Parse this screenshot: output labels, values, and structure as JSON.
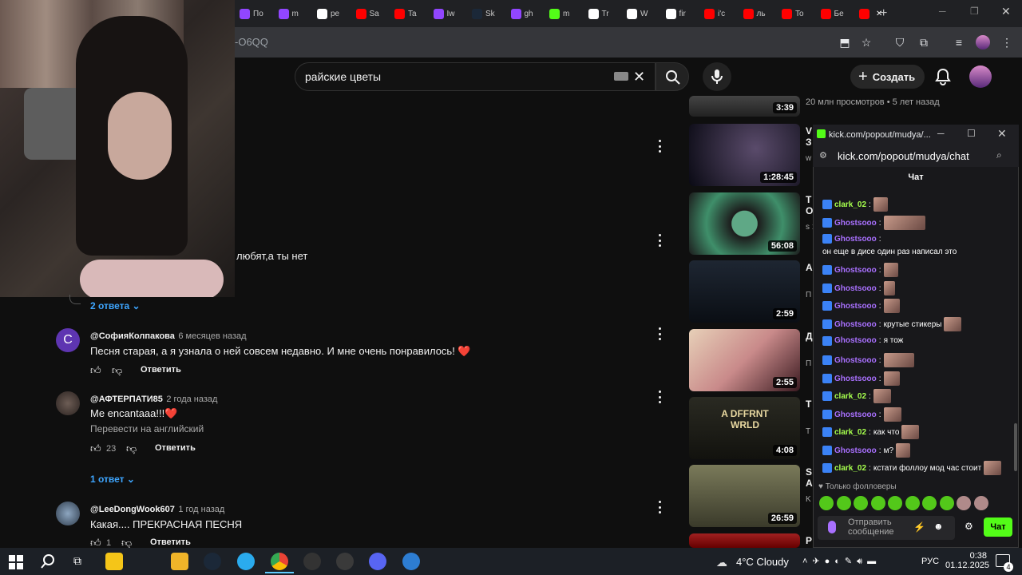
{
  "browser": {
    "tabs": [
      "По",
      "m",
      "ре",
      "Sa",
      "Ta",
      "Iw",
      "Sk",
      "gh",
      "m",
      "Tr",
      "W",
      "fir",
      "i'c",
      "ль",
      "To",
      "Бе",
      ""
    ],
    "address": "-O6QQ",
    "new_tab": "+"
  },
  "youtube": {
    "search_value": "райские цветы",
    "create_label": "Создать"
  },
  "comments": {
    "partial_text": "любят,а ты нет",
    "show_replies_1": "2 ответа",
    "c1": {
      "author": "@СофияКолпакова",
      "time": "6 месяцев назад",
      "text": "Песня старая, а я узнала о ней совсем недавно. И мне очень понравилось! ❤️",
      "reply": "Ответить",
      "avatar_letter": "С"
    },
    "c2": {
      "author": "@АФТЕРПАТИ85",
      "time": "2 года назад",
      "text": "Me encantaaa!!!❤️",
      "translate": "Перевести на английский",
      "likes": "23",
      "reply": "Ответить"
    },
    "show_replies_2": "1 ответ",
    "c3": {
      "author": "@LeeDongWook607",
      "time": "1 год назад",
      "text": "Какая.... ПРЕКРАСНАЯ ПЕСНЯ",
      "likes": "1",
      "reply": "Ответить"
    }
  },
  "sidebar": {
    "top_meta": "20 млн просмотров • 5 лет назад",
    "videos": [
      {
        "duration": "3:39",
        "title": "",
        "meta": ""
      },
      {
        "duration": "1:28:45",
        "title": "V З",
        "meta": "w"
      },
      {
        "duration": "56:08",
        "title": "Т О",
        "meta": "s 1,"
      },
      {
        "duration": "2:59",
        "title": "А",
        "meta": "П 15"
      },
      {
        "duration": "2:55",
        "title": "Д",
        "meta": "П 26"
      },
      {
        "duration": "4:08",
        "title": "Т",
        "meta": "Т 1"
      },
      {
        "duration": "26:59",
        "title": "S А",
        "meta": "K 7"
      },
      {
        "duration": "",
        "title": "Р",
        "meta": ""
      }
    ],
    "album_text": "A DFFRNT WRLD"
  },
  "kick": {
    "window_title": "kick.com/popout/mudya/...",
    "url": "kick.com/popout/mudya/chat",
    "header": "Чат",
    "messages": [
      {
        "user": "clark_02",
        "text": "",
        "color": "#a6ff4d"
      },
      {
        "user": "Ghostsooo",
        "text": "",
        "color": "#a970ff"
      },
      {
        "user": "Ghostsooo",
        "text": "он еще в дисе один раз написал это",
        "color": "#a970ff"
      },
      {
        "user": "Ghostsooo",
        "text": "",
        "color": "#a970ff"
      },
      {
        "user": "Ghostsooo",
        "text": "",
        "color": "#a970ff"
      },
      {
        "user": "Ghostsooo",
        "text": "",
        "color": "#a970ff"
      },
      {
        "user": "Ghostsooo",
        "text": "крутые стикеры",
        "color": "#a970ff"
      },
      {
        "user": "Ghostsooo",
        "text": "я тож",
        "color": "#a970ff"
      },
      {
        "user": "Ghostsooo",
        "text": "",
        "color": "#a970ff"
      },
      {
        "user": "Ghostsooo",
        "text": "",
        "color": "#a970ff"
      },
      {
        "user": "clark_02",
        "text": "",
        "color": "#a6ff4d"
      },
      {
        "user": "Ghostsooo",
        "text": "",
        "color": "#a970ff"
      },
      {
        "user": "clark_02",
        "text": "как что",
        "color": "#a6ff4d"
      },
      {
        "user": "Ghostsooo",
        "text": "м?",
        "color": "#a970ff"
      },
      {
        "user": "clark_02",
        "text": "кстати фоллоу мод час стоит",
        "color": "#a6ff4d"
      }
    ],
    "followers_only": "Только фолловеры",
    "input_placeholder": "Отправить сообщение",
    "send_label": "Чат"
  },
  "taskbar": {
    "weather": "4°C  Cloudy",
    "lang": "РУС",
    "time": "0:38",
    "date": "01.12.2025",
    "notifications": "4"
  }
}
